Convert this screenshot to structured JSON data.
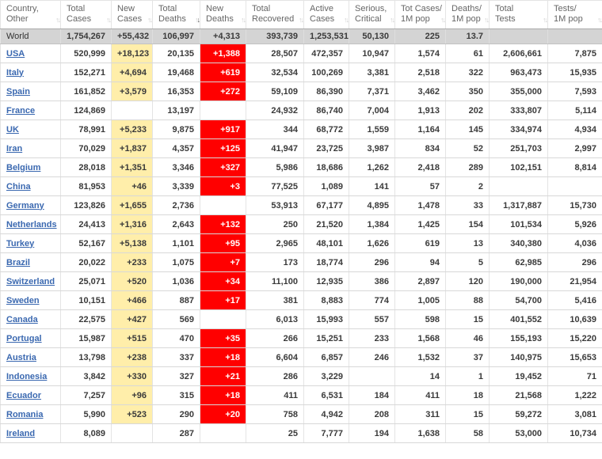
{
  "app": {
    "description": "COVID-19 coronavirus country statistics table",
    "sort_state": {
      "column": "total_deaths",
      "direction": "desc"
    }
  },
  "colors": {
    "link_blue": "#3a68b0",
    "new_cases_yellow": "#ffeeaa",
    "new_deaths_red": "#ff0000",
    "world_row_gray": "#d4d4d4",
    "header_text_gray": "#666666"
  },
  "icons": {
    "sort_inactive": "updown-arrows",
    "sort_active_desc": "down-arrow"
  },
  "table": {
    "columns": [
      {
        "id": "country",
        "lines": [
          "Country,",
          "Other"
        ],
        "sorted": null
      },
      {
        "id": "total_cases",
        "lines": [
          "Total",
          "Cases"
        ],
        "sorted": null
      },
      {
        "id": "new_cases",
        "lines": [
          "New",
          "Cases"
        ],
        "sorted": null
      },
      {
        "id": "total_deaths",
        "lines": [
          "Total",
          "Deaths"
        ],
        "sorted": "desc"
      },
      {
        "id": "new_deaths",
        "lines": [
          "New",
          "Deaths"
        ],
        "sorted": null
      },
      {
        "id": "total_recovered",
        "lines": [
          "Total",
          "Recovered"
        ],
        "sorted": null
      },
      {
        "id": "active_cases",
        "lines": [
          "Active",
          "Cases"
        ],
        "sorted": null
      },
      {
        "id": "serious_critical",
        "lines": [
          "Serious,",
          "Critical"
        ],
        "sorted": null
      },
      {
        "id": "cases_per_1m",
        "lines": [
          "Tot Cases/",
          "1M pop"
        ],
        "sorted": null
      },
      {
        "id": "deaths_per_1m",
        "lines": [
          "Deaths/",
          "1M pop"
        ],
        "sorted": null
      },
      {
        "id": "total_tests",
        "lines": [
          "Total",
          "Tests"
        ],
        "sorted": null
      },
      {
        "id": "tests_per_1m",
        "lines": [
          "Tests/",
          "1M pop"
        ],
        "sorted": null
      }
    ],
    "world_row": {
      "label": "World",
      "values": [
        "1,754,267",
        "+55,432",
        "106,997",
        "+4,313",
        "393,739",
        "1,253,531",
        "50,130",
        "225",
        "13.7",
        "",
        ""
      ]
    },
    "rows": [
      {
        "country": "USA",
        "values": [
          "520,999",
          "+18,123",
          "20,135",
          "+1,388",
          "28,507",
          "472,357",
          "10,947",
          "1,574",
          "61",
          "2,606,661",
          "7,875"
        ]
      },
      {
        "country": "Italy",
        "values": [
          "152,271",
          "+4,694",
          "19,468",
          "+619",
          "32,534",
          "100,269",
          "3,381",
          "2,518",
          "322",
          "963,473",
          "15,935"
        ]
      },
      {
        "country": "Spain",
        "values": [
          "161,852",
          "+3,579",
          "16,353",
          "+272",
          "59,109",
          "86,390",
          "7,371",
          "3,462",
          "350",
          "355,000",
          "7,593"
        ]
      },
      {
        "country": "France",
        "values": [
          "124,869",
          "",
          "13,197",
          "",
          "24,932",
          "86,740",
          "7,004",
          "1,913",
          "202",
          "333,807",
          "5,114"
        ]
      },
      {
        "country": "UK",
        "values": [
          "78,991",
          "+5,233",
          "9,875",
          "+917",
          "344",
          "68,772",
          "1,559",
          "1,164",
          "145",
          "334,974",
          "4,934"
        ]
      },
      {
        "country": "Iran",
        "values": [
          "70,029",
          "+1,837",
          "4,357",
          "+125",
          "41,947",
          "23,725",
          "3,987",
          "834",
          "52",
          "251,703",
          "2,997"
        ]
      },
      {
        "country": "Belgium",
        "values": [
          "28,018",
          "+1,351",
          "3,346",
          "+327",
          "5,986",
          "18,686",
          "1,262",
          "2,418",
          "289",
          "102,151",
          "8,814"
        ]
      },
      {
        "country": "China",
        "values": [
          "81,953",
          "+46",
          "3,339",
          "+3",
          "77,525",
          "1,089",
          "141",
          "57",
          "2",
          "",
          ""
        ]
      },
      {
        "country": "Germany",
        "values": [
          "123,826",
          "+1,655",
          "2,736",
          "",
          "53,913",
          "67,177",
          "4,895",
          "1,478",
          "33",
          "1,317,887",
          "15,730"
        ]
      },
      {
        "country": "Netherlands",
        "values": [
          "24,413",
          "+1,316",
          "2,643",
          "+132",
          "250",
          "21,520",
          "1,384",
          "1,425",
          "154",
          "101,534",
          "5,926"
        ]
      },
      {
        "country": "Turkey",
        "values": [
          "52,167",
          "+5,138",
          "1,101",
          "+95",
          "2,965",
          "48,101",
          "1,626",
          "619",
          "13",
          "340,380",
          "4,036"
        ]
      },
      {
        "country": "Brazil",
        "values": [
          "20,022",
          "+233",
          "1,075",
          "+7",
          "173",
          "18,774",
          "296",
          "94",
          "5",
          "62,985",
          "296"
        ]
      },
      {
        "country": "Switzerland",
        "values": [
          "25,071",
          "+520",
          "1,036",
          "+34",
          "11,100",
          "12,935",
          "386",
          "2,897",
          "120",
          "190,000",
          "21,954"
        ]
      },
      {
        "country": "Sweden",
        "values": [
          "10,151",
          "+466",
          "887",
          "+17",
          "381",
          "8,883",
          "774",
          "1,005",
          "88",
          "54,700",
          "5,416"
        ]
      },
      {
        "country": "Canada",
        "values": [
          "22,575",
          "+427",
          "569",
          "",
          "6,013",
          "15,993",
          "557",
          "598",
          "15",
          "401,552",
          "10,639"
        ]
      },
      {
        "country": "Portugal",
        "values": [
          "15,987",
          "+515",
          "470",
          "+35",
          "266",
          "15,251",
          "233",
          "1,568",
          "46",
          "155,193",
          "15,220"
        ]
      },
      {
        "country": "Austria",
        "values": [
          "13,798",
          "+238",
          "337",
          "+18",
          "6,604",
          "6,857",
          "246",
          "1,532",
          "37",
          "140,975",
          "15,653"
        ]
      },
      {
        "country": "Indonesia",
        "values": [
          "3,842",
          "+330",
          "327",
          "+21",
          "286",
          "3,229",
          "",
          "14",
          "1",
          "19,452",
          "71"
        ]
      },
      {
        "country": "Ecuador",
        "values": [
          "7,257",
          "+96",
          "315",
          "+18",
          "411",
          "6,531",
          "184",
          "411",
          "18",
          "21,568",
          "1,222"
        ]
      },
      {
        "country": "Romania",
        "values": [
          "5,990",
          "+523",
          "290",
          "+20",
          "758",
          "4,942",
          "208",
          "311",
          "15",
          "59,272",
          "3,081"
        ]
      },
      {
        "country": "Ireland",
        "values": [
          "8,089",
          "",
          "287",
          "",
          "25",
          "7,777",
          "194",
          "1,638",
          "58",
          "53,000",
          "10,734"
        ]
      }
    ]
  }
}
